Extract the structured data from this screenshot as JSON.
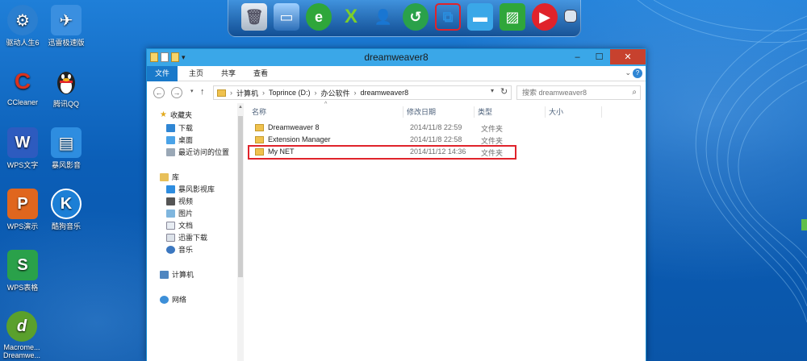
{
  "desktop": {
    "icons": [
      {
        "label": "驱动人生6",
        "icon": "gear-icon",
        "color": "#2b7fd0"
      },
      {
        "label": "迅雷极速版",
        "icon": "thunder-bird-icon",
        "color": "#3a8fe0"
      },
      {
        "label": "CCleaner",
        "icon": "ccleaner-icon",
        "color": "#d8321e"
      },
      {
        "label": "腾讯QQ",
        "icon": "qq-penguin-icon",
        "color": "#222222"
      },
      {
        "label": "WPS文字",
        "icon": "wps-writer-icon",
        "color": "#2d5bbf"
      },
      {
        "label": "暴风影音",
        "icon": "baofeng-player-icon",
        "color": "#2e8de0"
      },
      {
        "label": "WPS演示",
        "icon": "wps-presentation-icon",
        "color": "#e0661e"
      },
      {
        "label": "酷狗音乐",
        "icon": "kugou-music-icon",
        "color": "#1c7fd6"
      },
      {
        "label": "WPS表格",
        "icon": "wps-spreadsheet-icon",
        "color": "#2aa14a"
      },
      {
        "label": "Macrome... Dreamwe...",
        "icon": "dreamweaver-icon",
        "color": "#5aa02c"
      }
    ]
  },
  "dock": {
    "items": [
      "recycle-bin-icon",
      "computer-icon",
      "ie-browser-icon",
      "excel-x-icon",
      "user-icon",
      "restore-icon",
      "network-icon",
      "folder-icon",
      "picture-icon",
      "media-play-icon",
      "small-square-icon"
    ]
  },
  "window": {
    "title": "dreamweaver8",
    "ribbon_tabs": [
      "文件",
      "主页",
      "共享",
      "查看"
    ],
    "address": {
      "crumbs": [
        "计算机",
        "Toprince (D:)",
        "办公软件",
        "dreamweaver8"
      ]
    },
    "search_placeholder": "搜索 dreamweaver8",
    "nav": {
      "favorites": "收藏夹",
      "fav_items": [
        "下载",
        "桌面",
        "最近访问的位置"
      ],
      "library": "库",
      "lib_items": [
        "暴风影视库",
        "视频",
        "图片",
        "文档",
        "迅雷下载",
        "音乐"
      ],
      "computer": "计算机",
      "network": "网络"
    },
    "columns": {
      "name": "名称",
      "date": "修改日期",
      "type": "类型",
      "size": "大小"
    },
    "files": [
      {
        "name": "Dreamweaver 8",
        "date": "2014/11/8 22:59",
        "type": "文件夹"
      },
      {
        "name": "Extension Manager",
        "date": "2014/11/8 22:58",
        "type": "文件夹"
      },
      {
        "name": "My NET",
        "date": "2014/11/12 14:36",
        "type": "文件夹"
      }
    ]
  },
  "colors": {
    "titlebar": "#3aa7e8",
    "ribbon_active": "#1979ca",
    "close_button": "#c7412e",
    "highlight_border": "#e0232b",
    "folder": "#f0c24e"
  }
}
